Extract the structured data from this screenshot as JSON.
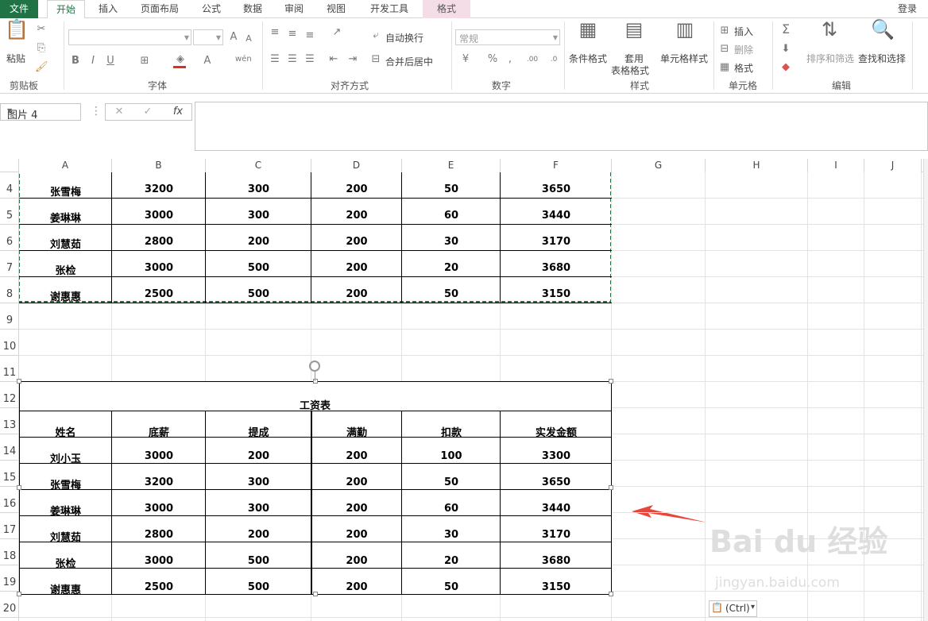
{
  "tabs": [
    "文件",
    "开始",
    "插入",
    "页面布局",
    "公式",
    "数据",
    "审阅",
    "视图",
    "开发工具",
    "格式"
  ],
  "login_label": "登录",
  "ribbon": {
    "paste": "粘贴",
    "clipboard": "剪贴板",
    "font_group": "字体",
    "wrap_text": "自动换行",
    "merge_center": "合并后居中",
    "align_group": "对齐方式",
    "number_format": "常规",
    "number_group": "数字",
    "cond_format": "条件格式",
    "table_format_1": "套用",
    "table_format_2": "表格格式",
    "cell_style": "单元格样式",
    "style_group": "样式",
    "insert": "插入",
    "delete": "删除",
    "format": "格式",
    "cells_group": "单元格",
    "sort_filter": "排序和筛选",
    "find_select": "查找和选择",
    "edit_group": "编辑"
  },
  "formula_bar": {
    "name_box": "图片 4",
    "formula": ""
  },
  "sheet": {
    "columns": [
      "A",
      "B",
      "C",
      "D",
      "E",
      "F",
      "G",
      "H",
      "I",
      "J"
    ],
    "row_numbers": [
      "4",
      "5",
      "6",
      "7",
      "8",
      "9",
      "10",
      "11",
      "12",
      "13",
      "14",
      "15",
      "16",
      "17",
      "18",
      "19",
      "20"
    ],
    "top_rows": [
      [
        "张雪梅",
        "3200",
        "300",
        "200",
        "50",
        "3650"
      ],
      [
        "姜琳琳",
        "3000",
        "300",
        "200",
        "60",
        "3440"
      ],
      [
        "刘慧茹",
        "2800",
        "200",
        "200",
        "30",
        "3170"
      ],
      [
        "张检",
        "3000",
        "500",
        "200",
        "20",
        "3680"
      ],
      [
        "谢惠惠",
        "2500",
        "500",
        "200",
        "50",
        "3150"
      ]
    ]
  },
  "picture": {
    "title": "工资表",
    "headers": [
      "姓名",
      "底薪",
      "提成",
      "满勤",
      "扣款",
      "实发金额"
    ],
    "rows": [
      [
        "刘小玉",
        "3000",
        "200",
        "200",
        "100",
        "3300"
      ],
      [
        "张雪梅",
        "3200",
        "300",
        "200",
        "50",
        "3650"
      ],
      [
        "姜琳琳",
        "3000",
        "300",
        "200",
        "60",
        "3440"
      ],
      [
        "刘慧茹",
        "2800",
        "200",
        "200",
        "30",
        "3170"
      ],
      [
        "张检",
        "3000",
        "500",
        "200",
        "20",
        "3680"
      ],
      [
        "谢惠惠",
        "2500",
        "500",
        "200",
        "50",
        "3150"
      ]
    ]
  },
  "paste_options": "(Ctrl)",
  "watermark": "Bai du 经验",
  "watermark_url": "jingyan.baidu.com",
  "colors": {
    "excel_green": "#217346",
    "copy_marquee": "#217346",
    "arrow": "#e8453c",
    "format_tab": "#f5dde8"
  }
}
